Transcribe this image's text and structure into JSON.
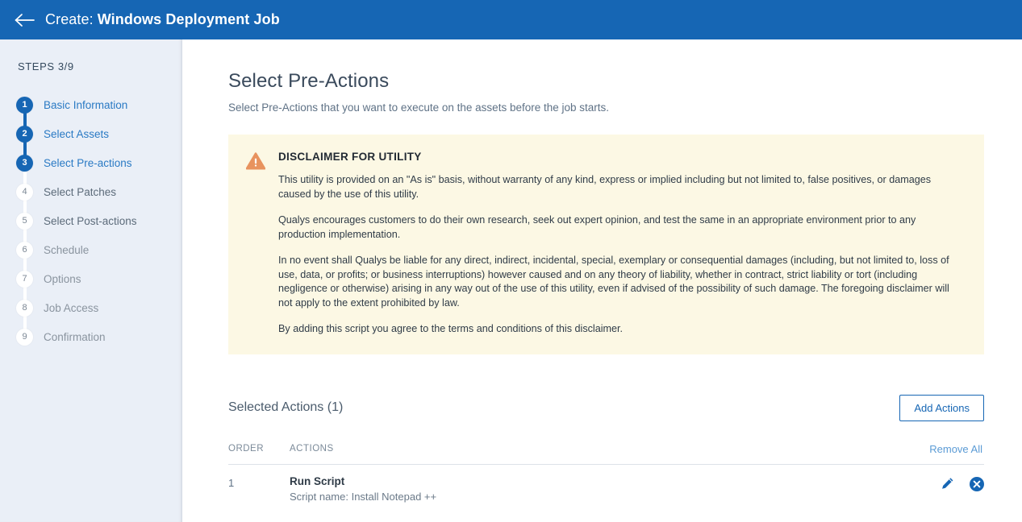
{
  "header": {
    "back_icon": "arrow-left-icon",
    "prefix": "Create:",
    "title": "Windows Deployment Job"
  },
  "sidebar": {
    "steps_label": "STEPS 3/9",
    "items": [
      {
        "number": "1",
        "label": "Basic Information",
        "state": "done"
      },
      {
        "number": "2",
        "label": "Select Assets",
        "state": "done"
      },
      {
        "number": "3",
        "label": "Select Pre-actions",
        "state": "active"
      },
      {
        "number": "4",
        "label": "Select Patches",
        "state": "next"
      },
      {
        "number": "5",
        "label": "Select Post-actions",
        "state": "next"
      },
      {
        "number": "6",
        "label": "Schedule",
        "state": "future"
      },
      {
        "number": "7",
        "label": "Options",
        "state": "future"
      },
      {
        "number": "8",
        "label": "Job Access",
        "state": "future"
      },
      {
        "number": "9",
        "label": "Confirmation",
        "state": "future"
      }
    ]
  },
  "main": {
    "title": "Select Pre-Actions",
    "subtitle": "Select Pre-Actions that you want to execute on the assets before the job starts.",
    "alert": {
      "icon": "warning-triangle-icon",
      "title": "DISCLAIMER FOR UTILITY",
      "paragraphs": [
        "This utility is provided on an \"As is\" basis, without warranty of any kind, express or implied including but not limited to, false positives, or damages caused by the use of this utility.",
        "Qualys encourages customers to do their own research, seek out expert opinion, and test the same in an appropriate environment prior to any production implementation.",
        "In no event shall Qualys be liable for any direct, indirect, incidental, special, exemplary or consequential damages (including, but not limited to, loss of use, data, or profits; or business interruptions) however caused and on any theory of liability, whether in contract, strict liability or tort (including negligence or otherwise) arising in any way out of the use of this utility, even if advised of the possibility of such damage. The foregoing disclaimer will not apply to the extent prohibited by law.",
        "By adding this script you agree to the terms and conditions of this disclaimer."
      ]
    },
    "selected_actions": {
      "title": "Selected Actions (1)",
      "add_button": "Add Actions",
      "remove_all": "Remove All",
      "columns": {
        "order": "ORDER",
        "actions": "ACTIONS"
      },
      "rows": [
        {
          "order": "1",
          "name": "Run Script",
          "detail": "Script name: Install Notepad ++",
          "edit_icon": "pencil-icon",
          "remove_icon": "close-circle-icon"
        }
      ]
    }
  },
  "colors": {
    "header_blue": "#1666b4",
    "sidebar_bg": "#eaeff7",
    "alert_bg": "#fcf8e4",
    "warning_orange": "#e8935e",
    "link_blue": "#2a7ac4"
  }
}
